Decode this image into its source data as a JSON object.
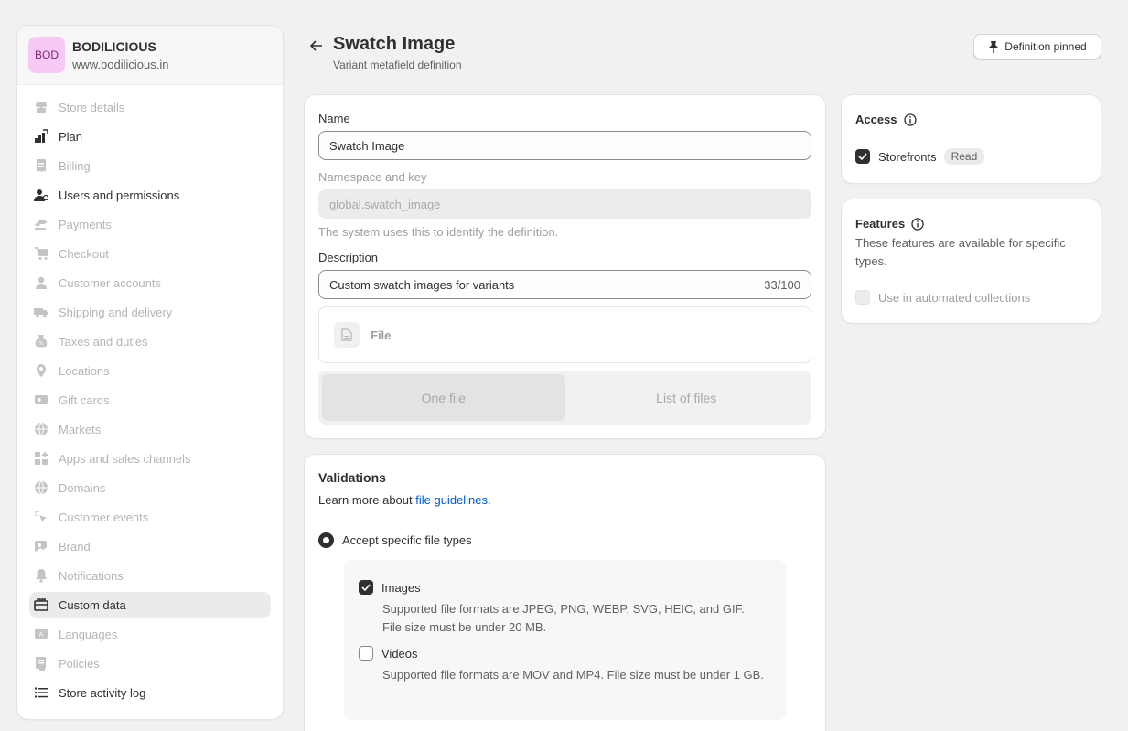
{
  "store": {
    "avatar": "BOD",
    "name": "BODILICIOUS",
    "url": "www.bodilicious.in"
  },
  "sidebar": {
    "items": [
      {
        "label": "Store details",
        "icon": "store-icon"
      },
      {
        "label": "Plan",
        "icon": "plan-icon"
      },
      {
        "label": "Billing",
        "icon": "billing-icon"
      },
      {
        "label": "Users and permissions",
        "icon": "users-icon"
      },
      {
        "label": "Payments",
        "icon": "payments-icon"
      },
      {
        "label": "Checkout",
        "icon": "cart-icon"
      },
      {
        "label": "Customer accounts",
        "icon": "person-icon"
      },
      {
        "label": "Shipping and delivery",
        "icon": "truck-icon"
      },
      {
        "label": "Taxes and duties",
        "icon": "tax-icon"
      },
      {
        "label": "Locations",
        "icon": "location-icon"
      },
      {
        "label": "Gift cards",
        "icon": "gift-card-icon"
      },
      {
        "label": "Markets",
        "icon": "globe-icon"
      },
      {
        "label": "Apps and sales channels",
        "icon": "apps-icon"
      },
      {
        "label": "Domains",
        "icon": "globe-icon"
      },
      {
        "label": "Customer events",
        "icon": "cursor-icon"
      },
      {
        "label": "Brand",
        "icon": "brand-icon"
      },
      {
        "label": "Notifications",
        "icon": "bell-icon"
      },
      {
        "label": "Custom data",
        "icon": "custom-data-icon"
      },
      {
        "label": "Languages",
        "icon": "language-icon"
      },
      {
        "label": "Policies",
        "icon": "policy-icon"
      },
      {
        "label": "Store activity log",
        "icon": "list-icon"
      }
    ]
  },
  "header": {
    "title": "Swatch Image",
    "subtitle": "Variant metafield definition",
    "pin_button": "Definition pinned"
  },
  "definition": {
    "name_label": "Name",
    "name_value": "Swatch Image",
    "ns_label": "Namespace and key",
    "ns_value": "global.swatch_image",
    "ns_help": "The system uses this to identify the definition.",
    "desc_label": "Description",
    "desc_value": "Custom swatch images for variants",
    "desc_counter": "33/100",
    "type_label": "File",
    "seg_one": "One file",
    "seg_list": "List of files"
  },
  "validations": {
    "title": "Validations",
    "learn_prefix": "Learn more about ",
    "learn_link": "file guidelines",
    "learn_suffix": ".",
    "radio_label": "Accept specific file types",
    "images_label": "Images",
    "images_desc": "Supported file formats are JPEG, PNG, WEBP, SVG, HEIC, and GIF. File size must be under 20 MB.",
    "videos_label": "Videos",
    "videos_desc": "Supported file formats are MOV and MP4. File size must be under 1 GB."
  },
  "access": {
    "title": "Access",
    "storefronts_label": "Storefronts",
    "badge": "Read"
  },
  "features": {
    "title": "Features",
    "desc": "These features are available for specific types.",
    "auto_label": "Use in automated collections"
  }
}
